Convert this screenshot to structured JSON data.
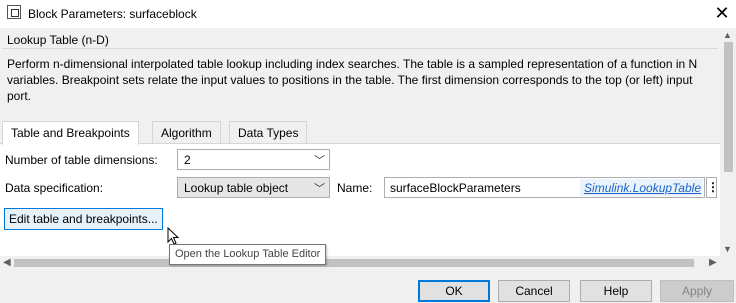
{
  "window": {
    "title": "Block Parameters: surfaceblock",
    "close_glyph": "✕"
  },
  "block": {
    "type": "Lookup Table (n-D)",
    "description": "Perform n-dimensional interpolated table lookup including index searches. The table is a sampled representation of a function in N variables. Breakpoint sets relate the input values to positions in the table. The first dimension corresponds to the top (or left) input port."
  },
  "tabs": [
    {
      "label": "Table and Breakpoints",
      "active": true
    },
    {
      "label": "Algorithm",
      "active": false
    },
    {
      "label": "Data Types",
      "active": false
    }
  ],
  "params": {
    "num_dims_label": "Number of table dimensions:",
    "num_dims_value": "2",
    "data_spec_label": "Data specification:",
    "data_spec_value": "Lookup table object",
    "name_label": "Name:",
    "name_value": "surfaceBlockParameters",
    "name_link": "Simulink.LookupTable",
    "more_glyph": "⋮",
    "edit_button": "Edit table and breakpoints..."
  },
  "tooltip": "Open the Lookup Table Editor",
  "buttons": {
    "ok": "OK",
    "cancel": "Cancel",
    "help": "Help",
    "apply": "Apply"
  },
  "icons": {
    "app": "block-parameters-icon",
    "chevron": "chevron-down-icon",
    "scroll_up": "scroll-up-icon",
    "scroll_down": "scroll-down-icon",
    "scroll_left": "scroll-left-icon",
    "scroll_right": "scroll-right-icon",
    "cursor": "mouse-pointer-icon"
  },
  "colors": {
    "link": "#1a64c8",
    "focus": "#0078d7"
  }
}
